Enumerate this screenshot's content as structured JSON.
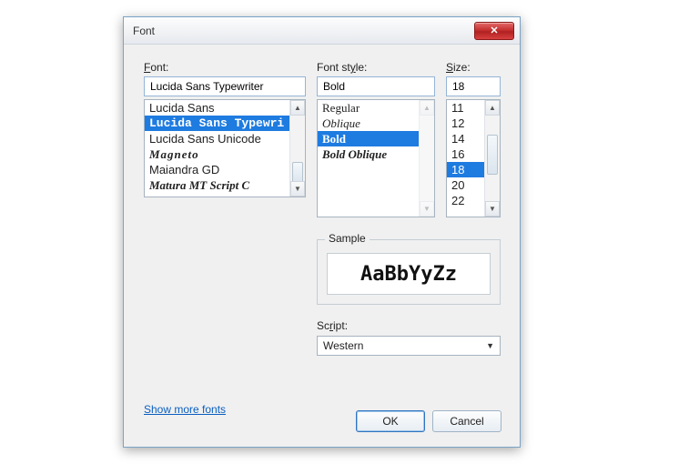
{
  "window": {
    "title": "Font",
    "close_glyph": "✕"
  },
  "labels": {
    "font": "Font:",
    "font_u": "F",
    "style": "Font style:",
    "style_u": "y",
    "size": "Size:",
    "size_u": "S",
    "sample": "Sample",
    "script": "Script:",
    "script_u": "r"
  },
  "font": {
    "value": "Lucida Sans Typewriter",
    "scroll_top_index": 0,
    "items": [
      {
        "label": "Lucida Sans",
        "css": "ff-lucida"
      },
      {
        "label": "Lucida Sans Typewri",
        "css": "ff-mono-bold",
        "selected": true
      },
      {
        "label": "Lucida Sans Unicode",
        "css": "ff-lucida-uni"
      },
      {
        "label": "Magneto",
        "css": "ff-magneto"
      },
      {
        "label": "Maiandra GD",
        "css": "ff-maiandra"
      },
      {
        "label": "Matura MT Script C",
        "css": "ff-matura"
      }
    ]
  },
  "style": {
    "value": "Bold",
    "items": [
      {
        "label": "Regular",
        "css": "style-regular"
      },
      {
        "label": "Oblique",
        "css": "style-oblique"
      },
      {
        "label": "Bold",
        "css": "style-bold",
        "selected": true
      },
      {
        "label": "Bold Oblique",
        "css": "style-boldobl"
      }
    ]
  },
  "size": {
    "value": "18",
    "items": [
      {
        "label": "11"
      },
      {
        "label": "12"
      },
      {
        "label": "14"
      },
      {
        "label": "16"
      },
      {
        "label": "18",
        "selected": true
      },
      {
        "label": "20"
      },
      {
        "label": "22"
      }
    ]
  },
  "sample_text": "AaBbYyZz",
  "script": {
    "value": "Western"
  },
  "link_text": "Show more fonts",
  "buttons": {
    "ok": "OK",
    "cancel": "Cancel"
  },
  "scrollbar": {
    "up": "▲",
    "down": "▼"
  }
}
